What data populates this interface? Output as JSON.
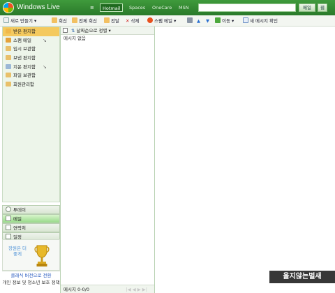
{
  "header": {
    "brand": "Windows Live",
    "menu_icon": "≡",
    "nav": [
      "Hotmail",
      "Spaces",
      "OneCare",
      "MSN"
    ],
    "search_placeholder": "",
    "search_button": "메일",
    "go_button": "웹"
  },
  "toolbar": {
    "items": [
      "새로 만들기",
      "회신",
      "전체 회신",
      "전달",
      "삭제",
      "스팸 메일",
      "이동",
      "새 메시지 확인"
    ],
    "icons": [
      "new-mail-icon",
      "reply-icon",
      "reply-all-icon",
      "forward-icon",
      "delete-icon",
      "junk-icon",
      "print-icon",
      "move-icon",
      "refresh-icon"
    ]
  },
  "folders": [
    {
      "label": "받은 편지함",
      "icon_color": "#f0b84a",
      "arrow": ""
    },
    {
      "label": "스팸 메일",
      "icon_color": "#e5a23a",
      "arrow": "↘"
    },
    {
      "label": "임시 보관함",
      "icon_color": "#e9c06a",
      "arrow": ""
    },
    {
      "label": "보낸 편지함",
      "icon_color": "#e9c06a",
      "arrow": ""
    },
    {
      "label": "지운 편지함",
      "icon_color": "#9bb7d6",
      "arrow": "↘"
    },
    {
      "label": "파일 보관함",
      "icon_color": "#e9c06a",
      "arrow": ""
    },
    {
      "label": "회원관리함",
      "icon_color": "#e9c06a",
      "arrow": ""
    }
  ],
  "sections": [
    "투데이",
    "메일",
    "연락처",
    "일정"
  ],
  "promo": {
    "text": "장원은 더 좋게"
  },
  "links": {
    "previous": "클래식 버전으로 전환",
    "privacy": "개인 정보 및 청소년 보호 정책"
  },
  "message_list": {
    "sort_label": "날짜순으로 정렬",
    "empty": "메시지 없음",
    "footer": "메시지 0-0/0",
    "pager": "|◀ ◀ ▶ ▶|"
  },
  "watermark": "울지않는벌새",
  "colors": {
    "header_green": "#2e8a2e",
    "selected_folder": "#f4c95e",
    "active_section": "#98d98a"
  }
}
